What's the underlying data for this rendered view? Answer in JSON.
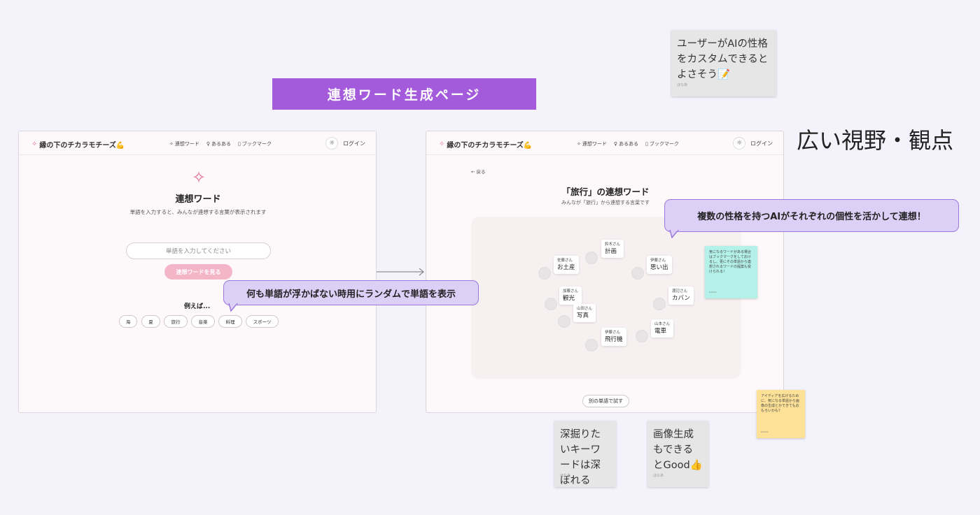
{
  "banner": "連想ワード生成ページ",
  "big_heading": "広い視野・観点",
  "stickies": {
    "top": {
      "text": "ユーザーがAIの性格をカスタムできるとよさそう📝",
      "author": "ほなあ"
    },
    "bottom_left": {
      "text": "深掘りたいキーワードは深ぼれる",
      "author": "ほなあ"
    },
    "bottom_right": {
      "text": "画像生成もできるとGood👍",
      "author": "ほなあ"
    },
    "cyan": {
      "text": "気になるワードがある場合はブックマークをしておけるし、更にその単語から連想されるワードの提案も受けられる！",
      "author": "kumiko"
    },
    "yellow": {
      "text": "アイディアを広げるために、気になる単語から画像の生成とかできてもおもろいかも？",
      "author": "kumiko"
    }
  },
  "callouts": {
    "random": "何も単語が浮かばない時用にランダムで単語を表示",
    "multi_ai": "複数の性格を持つAIがそれぞれの個性を活かして連想！"
  },
  "nav": {
    "logo": "縁の下のチカラモチーズ💪",
    "links": [
      "連想ワード",
      "あるある",
      "ブックマーク"
    ],
    "login": "ログイン"
  },
  "left_page": {
    "title": "連想ワード",
    "subtitle": "単語を入力すると、みんなが連想する言葉が表示されます",
    "input_placeholder": "単語を入力してください",
    "submit": "連想ワードを見る",
    "examples_title": "例えば...",
    "examples": [
      "海",
      "夏",
      "旅行",
      "音楽",
      "料理",
      "スポーツ"
    ]
  },
  "right_page": {
    "back": "← 戻る",
    "title": "「旅行」の連想ワード",
    "subtitle": "みんなが「旅行」から連想する言葉です",
    "nodes": [
      {
        "who": "鈴木さん",
        "word": "計画"
      },
      {
        "who": "佐藤さん",
        "word": "お土産"
      },
      {
        "who": "伊藤さん",
        "word": "思い出"
      },
      {
        "who": "加藤さん",
        "word": "観光"
      },
      {
        "who": "渡辺さん",
        "word": "カバン"
      },
      {
        "who": "山田さん",
        "word": "写真"
      },
      {
        "who": "山本さん",
        "word": "電車"
      },
      {
        "who": "伊藤さん",
        "word": "飛行機"
      }
    ],
    "retry": "別の単語で試す"
  }
}
